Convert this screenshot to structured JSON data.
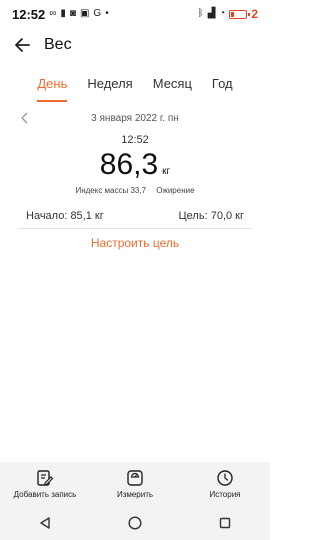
{
  "status_bar": {
    "time": "12:52",
    "left_icons": [
      "loop-icon",
      "sim-icon",
      "instagram-icon",
      "gallery-icon",
      "g-icon",
      "dot-icon"
    ],
    "right_icons": [
      "bluetooth-icon",
      "signal-icon",
      "wifi-icon"
    ],
    "battery_text": "2",
    "battery_color": "#e2461f"
  },
  "app_bar": {
    "title": "Вес"
  },
  "tabs": [
    {
      "label": "День",
      "active": true
    },
    {
      "label": "Неделя",
      "active": false
    },
    {
      "label": "Месяц",
      "active": false
    },
    {
      "label": "Год",
      "active": false
    }
  ],
  "date": {
    "label": "3 января 2022 г. пн"
  },
  "measurement": {
    "time": "12:52",
    "value": "86,3",
    "unit": "кг",
    "bmi_label": "Индекс массы 33,7",
    "bmi_status": "Ожирение"
  },
  "goal": {
    "start": "Начало: 85,1 кг",
    "target": "Цель: 70,0 кг",
    "set_goal_label": "Настроить цель"
  },
  "bottom_nav": [
    {
      "label": "Добавить запись",
      "icon": "edit-note-icon"
    },
    {
      "label": "Измерить",
      "icon": "scale-icon"
    },
    {
      "label": "История",
      "icon": "clock-icon"
    }
  ],
  "colors": {
    "accent": "#f26a2e"
  }
}
